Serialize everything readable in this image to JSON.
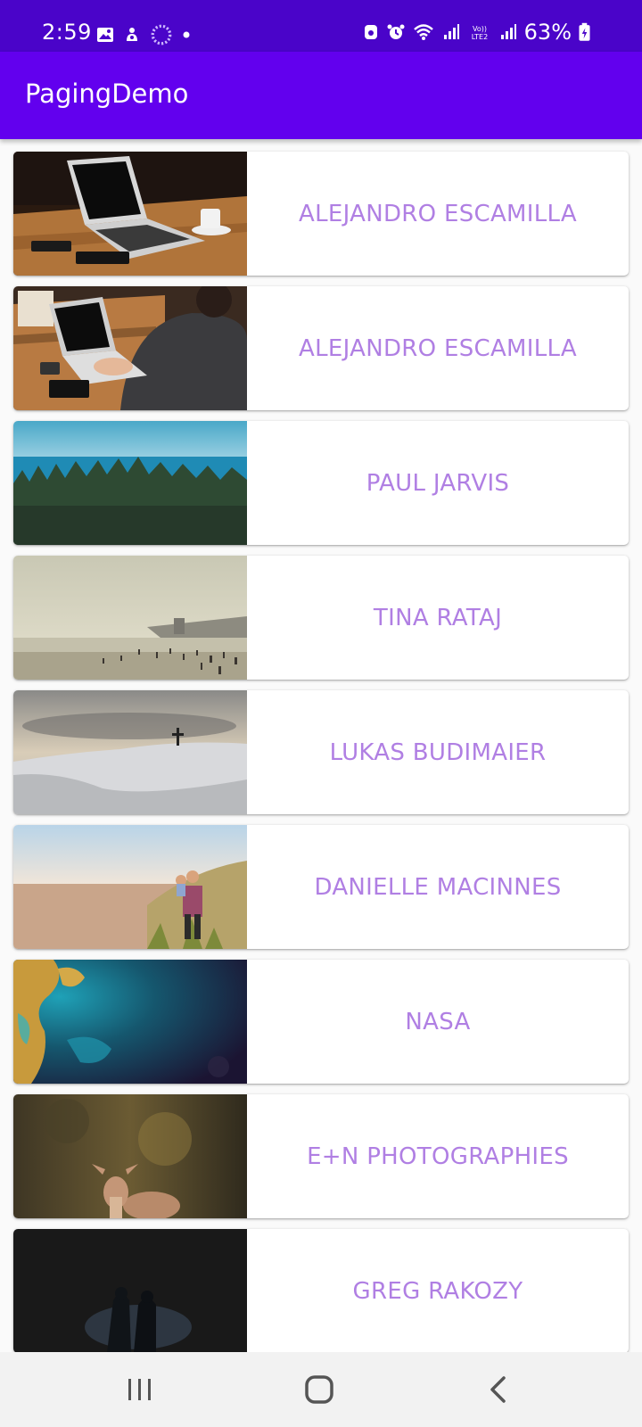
{
  "status_bar": {
    "time": "2:59",
    "battery_percent": "63%",
    "left_icons": [
      "gallery-icon",
      "notification-icon",
      "sync-icon",
      "dot-icon"
    ],
    "right_icons": [
      "app-icon",
      "alarm-icon",
      "wifi-icon",
      "signal-icon",
      "volte-icon",
      "signal-icon",
      "battery-icon"
    ]
  },
  "app_bar": {
    "title": "PagingDemo"
  },
  "items": [
    {
      "author": "ALEJANDRO ESCAMILLA",
      "image": "laptop-on-desk-photo"
    },
    {
      "author": "ALEJANDRO ESCAMILLA",
      "image": "person-typing-laptop-photo"
    },
    {
      "author": "PAUL JARVIS",
      "image": "forest-lake-photo"
    },
    {
      "author": "TINA RATAJ",
      "image": "foggy-beach-photo"
    },
    {
      "author": "LUKAS BUDIMAIER",
      "image": "snowy-summit-cross-photo"
    },
    {
      "author": "DANIELLE MACINNES",
      "image": "father-child-beach-photo"
    },
    {
      "author": "NASA",
      "image": "earth-from-space-photo"
    },
    {
      "author": "E+N PHOTOGRAPHIES",
      "image": "fawn-in-forest-photo"
    },
    {
      "author": "GREG RAKOZY",
      "image": "couple-in-dark-photo"
    }
  ],
  "nav_bar": {
    "buttons": [
      "recents-button",
      "home-button",
      "back-button"
    ]
  },
  "colors": {
    "status_bar": "#4a04c9",
    "app_bar": "#6200ee",
    "author_text": "#b07fe3"
  }
}
